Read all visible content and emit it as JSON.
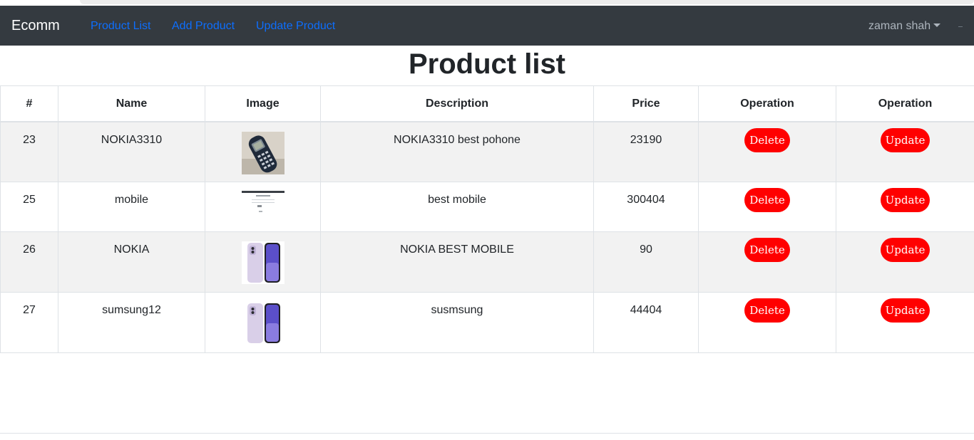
{
  "navbar": {
    "brand": "Ecomm",
    "links": [
      "Product List",
      "Add Product",
      "Update Product"
    ],
    "user": "zaman shah"
  },
  "page": {
    "title": "Product list"
  },
  "table": {
    "headers": [
      "#",
      "Name",
      "Image",
      "Description",
      "Price",
      "Operation",
      "Operation"
    ],
    "rows": [
      {
        "id": "23",
        "name": "NOKIA3310",
        "image": "nokia-3310-photo",
        "description": "NOKIA3310 best pohone",
        "price": "23190",
        "delete": "Delete",
        "update": "Update"
      },
      {
        "id": "25",
        "name": "mobile",
        "image": "screenshot-thumbnail",
        "description": "best mobile",
        "price": "300404",
        "delete": "Delete",
        "update": "Update"
      },
      {
        "id": "26",
        "name": "NOKIA",
        "image": "iphone-purple-photo",
        "description": "NOKIA BEST MOBILE",
        "price": "90",
        "delete": "Delete",
        "update": "Update"
      },
      {
        "id": "27",
        "name": "sumsung12",
        "image": "iphone-purple-photo",
        "description": "susmsung",
        "price": "44404",
        "delete": "Delete",
        "update": "Update"
      }
    ]
  },
  "colors": {
    "navbar": "#343a40",
    "link": "#0d6efd",
    "button": "#ff0000",
    "stripe": "#f2f2f2"
  }
}
